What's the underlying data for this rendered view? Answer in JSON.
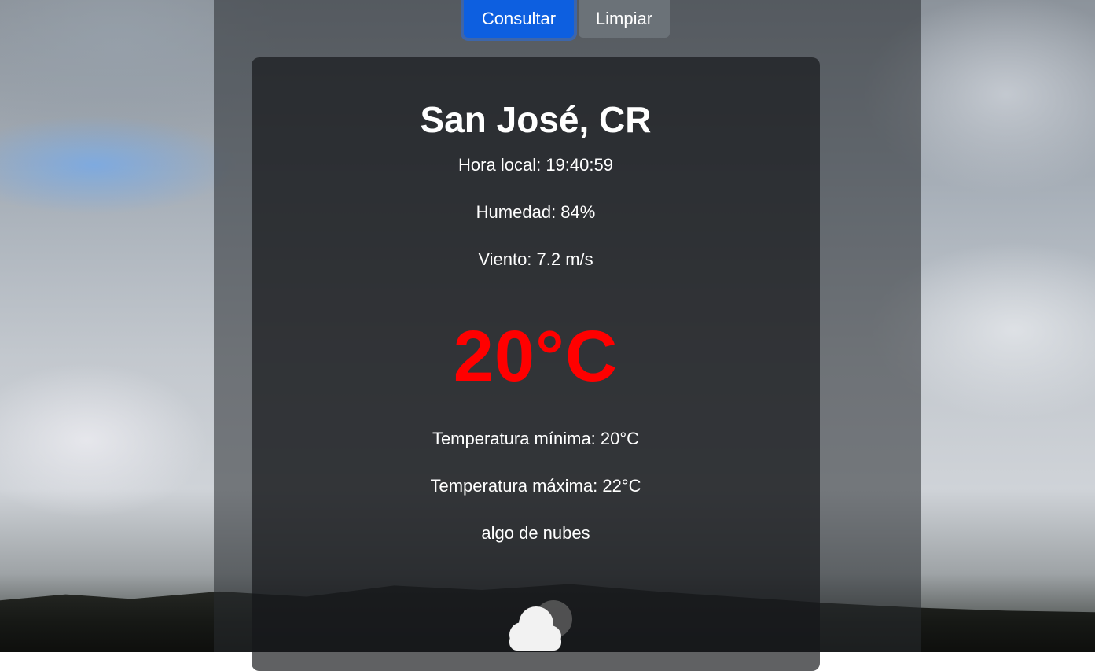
{
  "actions": {
    "consultar_label": "Consultar",
    "limpiar_label": "Limpiar"
  },
  "weather": {
    "city": "San José, CR",
    "local_time": "Hora local: 19:40:59",
    "humidity": "Humedad: 84%",
    "wind": "Viento: 7.2 m/s",
    "temperature": "20°C",
    "temp_min": "Temperatura mínima: 20°C",
    "temp_max": "Temperatura máxima: 22°C",
    "description": "algo de nubes",
    "icon": "partly-cloudy-night-icon"
  },
  "colors": {
    "primary_button": "#0d5fe0",
    "secondary_button": "#6b7278",
    "temperature_text": "#ff0000"
  }
}
